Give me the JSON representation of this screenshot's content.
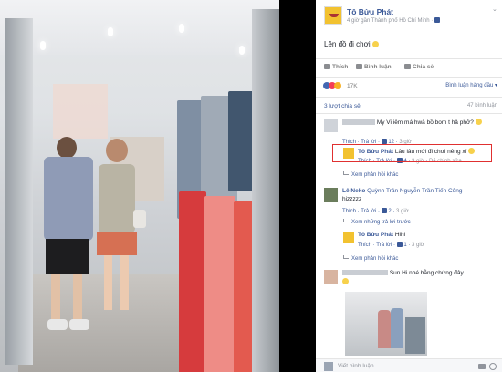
{
  "post": {
    "author": "Tô Bửu Phát",
    "meta": "4 giờ gần Thành phố Hồ Chí Minh · ",
    "caption": "Lên đồ đi chơi",
    "actions": {
      "like": "Thích",
      "comment": "Bình luận",
      "share": "Chia sẻ"
    },
    "reactions_count": "17K",
    "sort_label": "Bình luận hàng đầu ▾",
    "shares_label": "3 lượt chia sẻ",
    "views_label": "47 bình luận"
  },
  "comments": [
    {
      "text": "My Vi iêm má hwà bồ bom t hả phở?",
      "links": {
        "like": "Thích",
        "reply": "Trả lời",
        "count": "12",
        "time": "3 giờ"
      }
    },
    {
      "name": "Tô Bửu Phát",
      "text": "Lâu lâu mới đi chơi nêng xí",
      "links": {
        "like": "Thích",
        "reply": "Trả lời",
        "count": "4",
        "time": "3 giờ",
        "edited": "Đã chỉnh sửa"
      }
    },
    {
      "more": "Xem phản hồi khác"
    },
    {
      "name": "Lê Neko",
      "text": "Quỳnh Trần Nguyễn Trần Tiến Công",
      "text2": "hizzzzz",
      "links": {
        "like": "Thích",
        "reply": "Trả lời",
        "count": "2",
        "time": "3 giờ"
      }
    },
    {
      "more": "Xem những trả lời trước"
    },
    {
      "name": "Tô Bửu Phát",
      "text": "Hihi",
      "links": {
        "like": "Thích",
        "reply": "Trả lời",
        "count": "1",
        "time": "3 giờ"
      }
    },
    {
      "more": "Xem phản hồi khác"
    },
    {
      "text": "Sun Hi nhé bằng chứng đây"
    }
  ],
  "composer": {
    "placeholder": "Viết bình luận..."
  },
  "colors": {
    "fb_blue": "#3b5998",
    "highlight": "#e03030",
    "link_gray": "#90949c"
  }
}
